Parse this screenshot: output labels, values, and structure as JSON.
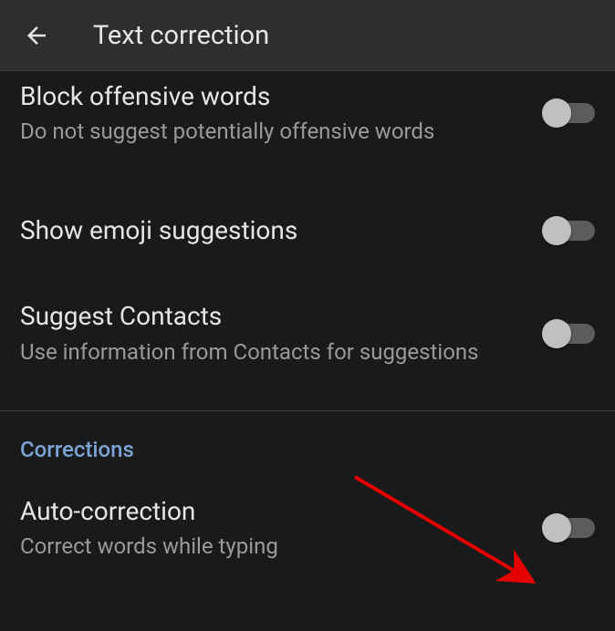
{
  "header": {
    "title": "Text correction"
  },
  "settings": {
    "block_offensive": {
      "title": "Block offensive words",
      "desc": "Do not suggest potentially offensive words",
      "enabled": false
    },
    "emoji_suggestions": {
      "title": "Show emoji suggestions",
      "enabled": false
    },
    "suggest_contacts": {
      "title": "Suggest Contacts",
      "desc": "Use information from Contacts for suggestions",
      "enabled": false
    },
    "auto_correction": {
      "title": "Auto-correction",
      "desc": "Correct words while typing",
      "enabled": false
    }
  },
  "sections": {
    "corrections": "Corrections"
  }
}
